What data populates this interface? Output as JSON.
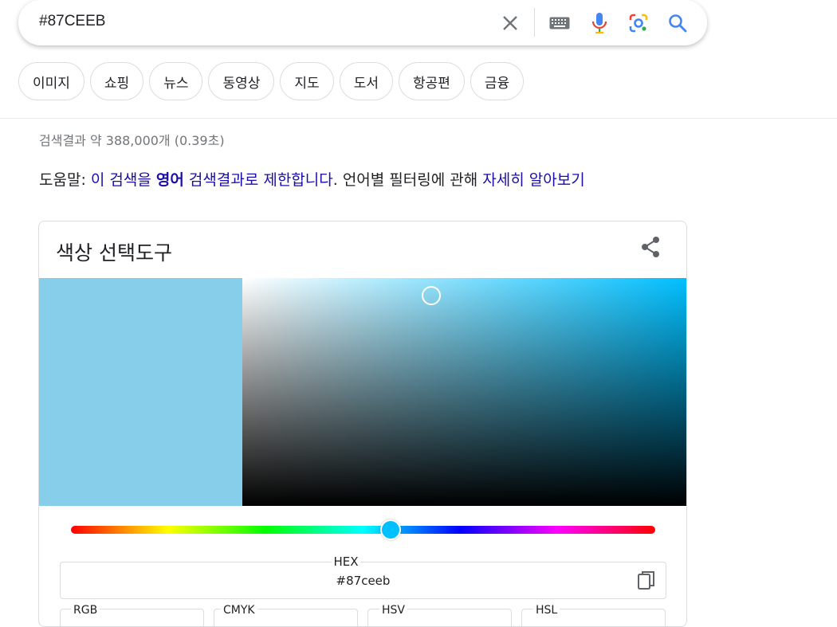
{
  "search": {
    "query": "#87CEEB",
    "clear_icon": "close-icon",
    "keyboard_icon": "keyboard-icon",
    "voice_icon": "mic-icon",
    "lens_icon": "lens-icon",
    "search_icon": "search-icon"
  },
  "chips": [
    "이미지",
    "쇼핑",
    "뉴스",
    "동영상",
    "지도",
    "도서",
    "항공편",
    "금융"
  ],
  "results": {
    "stats": "검색결과 약 388,000개 (0.39초)"
  },
  "help": {
    "prefix": "도움말: ",
    "link1_a": "이 검색을 ",
    "link1_bold": "영어",
    "link1_b": " 검색결과로 제한합니다",
    "middle": ". 언어별 필터링에 관해 ",
    "link2": "자세히 알아보기"
  },
  "color_picker": {
    "title": "색상 선택도구",
    "share_icon": "share-icon",
    "swatch_color": "#87ceeb",
    "hue_color": "#00bfff",
    "hex_label": "HEX",
    "hex_value": "#87ceeb",
    "copy_icon": "copy-icon",
    "fields": [
      "RGB",
      "CMYK",
      "HSV",
      "HSL"
    ]
  }
}
